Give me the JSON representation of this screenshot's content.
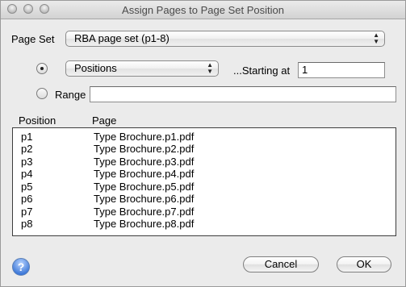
{
  "window": {
    "title": "Assign Pages to Page Set Position"
  },
  "page_set": {
    "label": "Page Set",
    "selected": "RBA page set (p1-8)"
  },
  "mode": {
    "positions_selected": true,
    "positions_option": "Positions",
    "starting_label": "...Starting at",
    "starting_value": "1",
    "range_label": "Range",
    "range_value": ""
  },
  "table": {
    "headers": {
      "position": "Position",
      "page": "Page"
    },
    "rows": [
      {
        "position": "p1",
        "page": "Type Brochure.p1.pdf"
      },
      {
        "position": "p2",
        "page": "Type Brochure.p2.pdf"
      },
      {
        "position": "p3",
        "page": "Type Brochure.p3.pdf"
      },
      {
        "position": "p4",
        "page": "Type Brochure.p4.pdf"
      },
      {
        "position": "p5",
        "page": "Type Brochure.p5.pdf"
      },
      {
        "position": "p6",
        "page": "Type Brochure.p6.pdf"
      },
      {
        "position": "p7",
        "page": "Type Brochure.p7.pdf"
      },
      {
        "position": "p8",
        "page": "Type Brochure.p8.pdf"
      }
    ]
  },
  "buttons": {
    "cancel": "Cancel",
    "ok": "OK",
    "help": "?"
  },
  "icons": {
    "help": "help-icon",
    "close": "close-icon",
    "minimize": "minimize-icon",
    "zoom": "zoom-icon"
  }
}
